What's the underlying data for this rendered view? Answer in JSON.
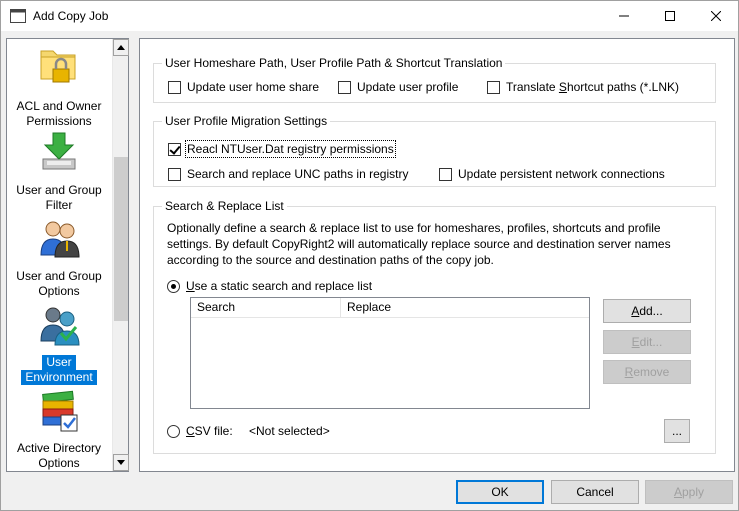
{
  "window": {
    "title": "Add Copy Job"
  },
  "sidebar": {
    "items": [
      {
        "label_line1": "ACL and Owner",
        "label_line2": "Permissions",
        "icon": "folder-lock-icon"
      },
      {
        "label_line1": "User and Group",
        "label_line2": "Filter",
        "icon": "download-filter-icon"
      },
      {
        "label_line1": "User and Group",
        "label_line2": "Options",
        "icon": "users-icon"
      },
      {
        "label_line1": "User",
        "label_line2": "Environment",
        "icon": "user-environment-icon",
        "selected": true
      },
      {
        "label_line1": "Active Directory",
        "label_line2": "Options",
        "icon": "books-icon"
      }
    ]
  },
  "homeshare_group": {
    "title": "User Homeshare Path, User Profile Path & Shortcut Translation",
    "update_home_share": {
      "label": "Update user home share",
      "checked": false
    },
    "update_profile": {
      "label": "Update user profile",
      "checked": false
    },
    "translate_shortcut": {
      "label_pre": "Translate ",
      "label_u": "S",
      "label_post": "hortcut paths (*.LNK)",
      "checked": false
    }
  },
  "profile_group": {
    "title": "User Profile Migration Settings",
    "reacl": {
      "label": "Reacl NTUser.Dat registry permissions",
      "checked": true
    },
    "search_unc": {
      "label": "Search and replace UNC paths in registry",
      "checked": false
    },
    "update_network": {
      "label": "Update persistent network connections",
      "checked": false
    }
  },
  "replace_group": {
    "title": "Search & Replace List",
    "description_line1": "Optionally define a search & replace list to use for homeshares, profiles, shortcuts and profile",
    "description_line2": "settings. By default CopyRight2 will automatically replace source and destination server names",
    "description_line3": "according to the source and destination paths of the copy job.",
    "static_list": {
      "label_u": "U",
      "label_post": "se a static search and replace list",
      "selected": true
    },
    "columns": [
      "Search",
      "Replace"
    ],
    "csv": {
      "label_u": "C",
      "label_post": "SV file:",
      "value": "<Not selected>",
      "selected": false
    },
    "add_btn": {
      "label_u": "A",
      "label_post": "dd..."
    },
    "edit_btn": {
      "label_u": "E",
      "label_post": "dit..."
    },
    "remove_btn": {
      "label_u": "R",
      "label_post": "emove"
    },
    "browse_btn": "..."
  },
  "footer": {
    "ok": "OK",
    "cancel": "Cancel",
    "apply_u": "A",
    "apply_post": "pply"
  },
  "colors": {
    "selection": "#0078d7",
    "border": "#828790",
    "disabled_text": "#a0a0a0"
  }
}
